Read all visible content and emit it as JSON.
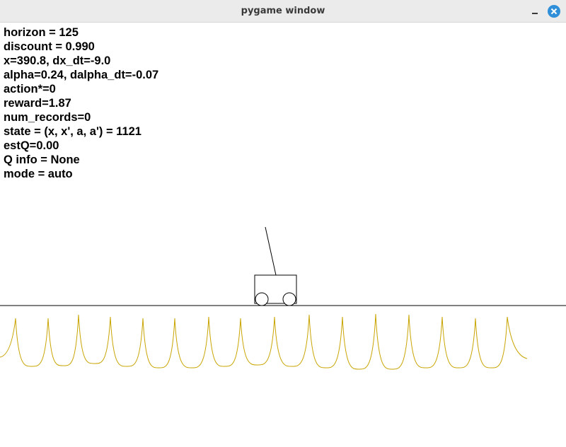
{
  "window": {
    "title": "pygame window"
  },
  "hud": {
    "lines": [
      "horizon = 125",
      "discount = 0.990",
      "x=390.8, dx_dt=-9.0",
      "alpha=0.24, dalpha_dt=-0.07",
      "action*=0",
      "reward=1.87",
      "num_records=0",
      "state = (x, x', a, a') = 1121",
      "estQ=0.00",
      "Q info = None",
      "mode = auto"
    ]
  },
  "colors": {
    "close_button": "#2f8fd8",
    "track": "#000000",
    "reward_curve": "#c8a400"
  },
  "icons": {
    "minimize": "minimize-icon",
    "close": "close-icon"
  }
}
